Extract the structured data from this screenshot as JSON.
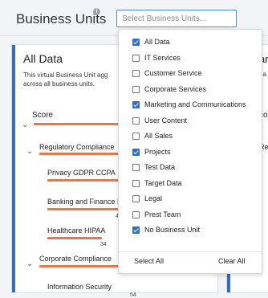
{
  "header": {
    "title": "Business Units",
    "info_icon": "i"
  },
  "search": {
    "placeholder": "Select Business Units..."
  },
  "card": {
    "title": "All Data",
    "description": "This virtual Business Unit agg... across all business units.",
    "desc_line1": "This virtual Business Unit agg",
    "desc_line2": "across all business units."
  },
  "card2": {
    "title": "ark",
    "desc": "na"
  },
  "tree": {
    "score": "Score",
    "regulatory": "Regulatory Compliance",
    "privacy": "Privacy GDPR CCPA",
    "banking": "Banking and Finance F",
    "banking_num": "4",
    "healthcare": "Healthcare HIPAA",
    "healthcare_num": "34",
    "corporate": "Corporate Compliance",
    "corporate_num": "54",
    "info_security": "Information Security",
    "right_score": "co",
    "right_reg": "Re"
  },
  "dropdown": {
    "options": [
      {
        "label": "All Data",
        "checked": true
      },
      {
        "label": "IT Services",
        "checked": false
      },
      {
        "label": "Customer Service",
        "checked": false
      },
      {
        "label": "Corporate Services",
        "checked": false
      },
      {
        "label": "Marketing and Communications",
        "checked": true
      },
      {
        "label": "User Content",
        "checked": false
      },
      {
        "label": "All Sales",
        "checked": false
      },
      {
        "label": "Projects",
        "checked": true
      },
      {
        "label": "Test Data",
        "checked": false
      },
      {
        "label": "Target Data",
        "checked": false
      },
      {
        "label": "Legal",
        "checked": false
      },
      {
        "label": "Prest Team",
        "checked": false
      },
      {
        "label": "No Business Unit",
        "checked": true
      }
    ],
    "select_all": "Select All",
    "clear_all": "Clear All"
  },
  "colors": {
    "accent": "#2f6fc4",
    "bar": "#e8764a"
  }
}
